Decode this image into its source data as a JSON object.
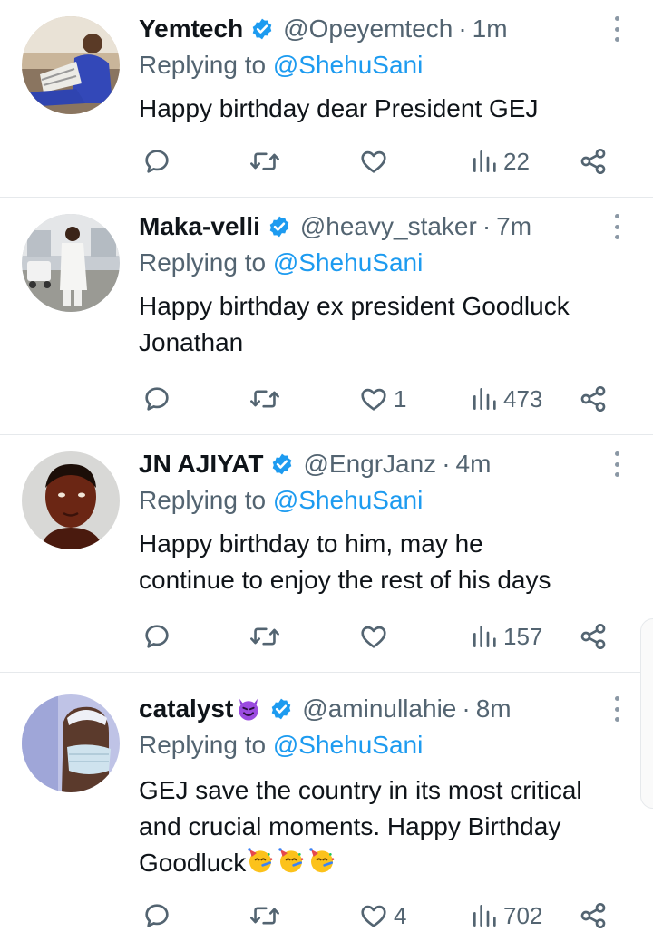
{
  "tweets": [
    {
      "display_name": "Yemtech",
      "name_emoji": "",
      "handle": "@Opeyemtech",
      "time": "1m",
      "replying_prefix": "Replying to",
      "replying_to": "@ShehuSani",
      "lines": [
        "Happy birthday dear President GEJ"
      ],
      "reply_count": "",
      "retweet_count": "",
      "like_count": "",
      "view_count": "22",
      "avatar": "man-reading-newspaper"
    },
    {
      "display_name": "Maka-velli",
      "name_emoji": "",
      "handle": "@heavy_staker",
      "time": "7m",
      "replying_prefix": "Replying to",
      "replying_to": "@ShehuSani",
      "lines": [
        "Happy birthday ex president Goodluck",
        "Jonathan"
      ],
      "reply_count": "",
      "retweet_count": "",
      "like_count": "1",
      "view_count": "473",
      "avatar": "man-in-white-outdoors"
    },
    {
      "display_name": "JN AJIYAT",
      "name_emoji": "",
      "handle": "@EngrJanz",
      "time": "4m",
      "replying_prefix": "Replying to",
      "replying_to": "@ShehuSani",
      "lines": [
        "Happy birthday to him, may he",
        "continue to enjoy the rest of his days"
      ],
      "reply_count": "",
      "retweet_count": "",
      "like_count": "",
      "view_count": "157",
      "avatar": "3d-rendered-face"
    },
    {
      "display_name": "catalyst",
      "name_emoji": "smiling-devil-emoji",
      "handle": "@aminullahie",
      "time": "8m",
      "replying_prefix": "Replying to",
      "replying_to": "@ShehuSani",
      "lines": [
        "GEJ save the country in its most critical",
        "and crucial moments. Happy Birthday",
        "Goodluck"
      ],
      "trailing_emojis": [
        "partying-face-emoji",
        "partying-face-emoji",
        "partying-face-emoji"
      ],
      "reply_count": "",
      "retweet_count": "",
      "like_count": "4",
      "view_count": "702",
      "avatar": "man-with-face-mask"
    }
  ],
  "icons": {
    "verified": "verified-badge-icon",
    "reply": "reply-icon",
    "retweet": "retweet-icon",
    "like": "like-icon",
    "views": "views-icon",
    "share": "share-icon",
    "more": "more-vertical-icon"
  },
  "colors": {
    "verified": "#1d9bf0",
    "mention": "#1d9bf0",
    "secondary_text": "#536471",
    "primary_text": "#0f1419",
    "divider": "#e6e9ec"
  }
}
